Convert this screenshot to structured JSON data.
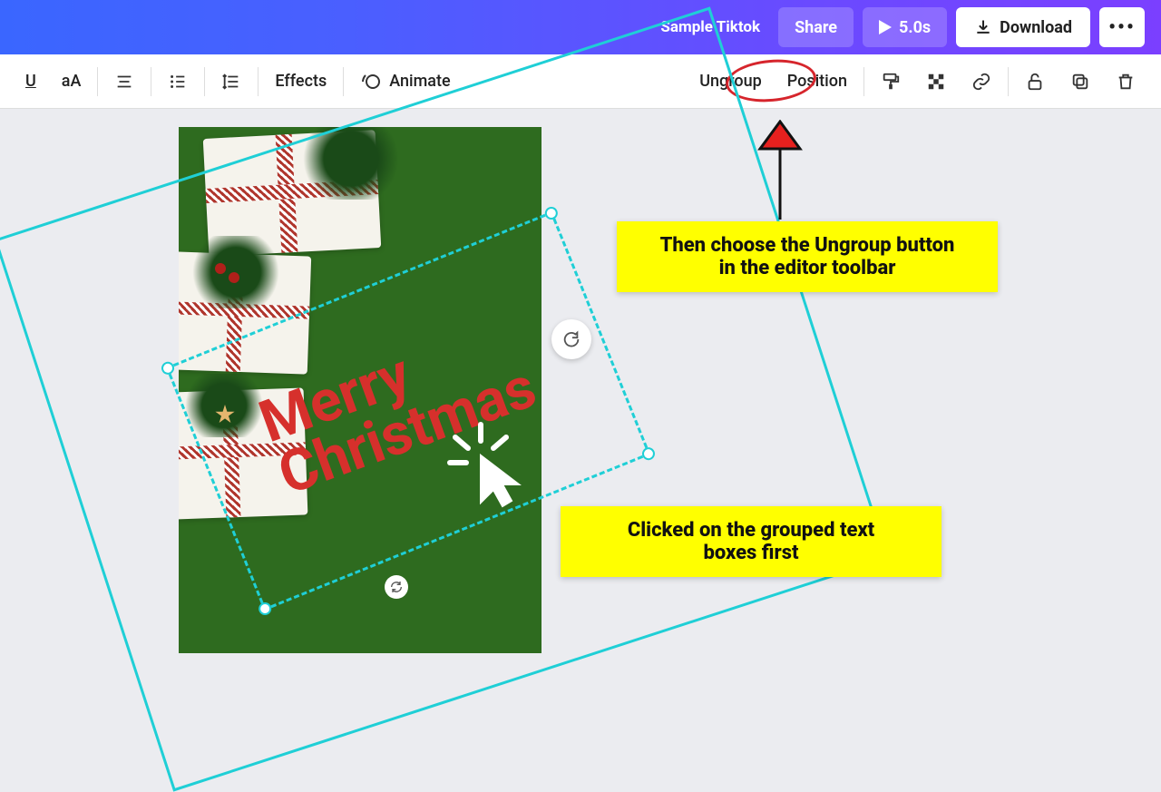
{
  "header": {
    "project_title": "Sample Tiktok",
    "share_label": "Share",
    "duration_label": "5.0s",
    "download_label": "Download"
  },
  "toolbar": {
    "underline": "U",
    "text_size": "aA",
    "effects": "Effects",
    "animate": "Animate",
    "ungroup": "Ungroup",
    "position": "Position"
  },
  "canvas": {
    "script_line1": "Merry",
    "script_line2": "Christmas"
  },
  "annotations": {
    "callout1_line1": "Then choose the Ungroup button",
    "callout1_line2": "in the editor toolbar",
    "callout2_line1": "Clicked on the grouped text",
    "callout2_line2": "boxes first"
  },
  "icons": {
    "align": "align-icon",
    "list": "list-icon",
    "spacing": "spacing-icon",
    "motion": "motion-circle-icon",
    "paint": "paint-roller-icon",
    "transparency": "transparency-icon",
    "link": "link-icon",
    "lock": "lock-icon",
    "copy": "copy-icon",
    "trash": "trash-icon",
    "download": "download-icon",
    "more": "more-icon",
    "rotate": "rotate-icon",
    "sync": "sync-icon"
  }
}
